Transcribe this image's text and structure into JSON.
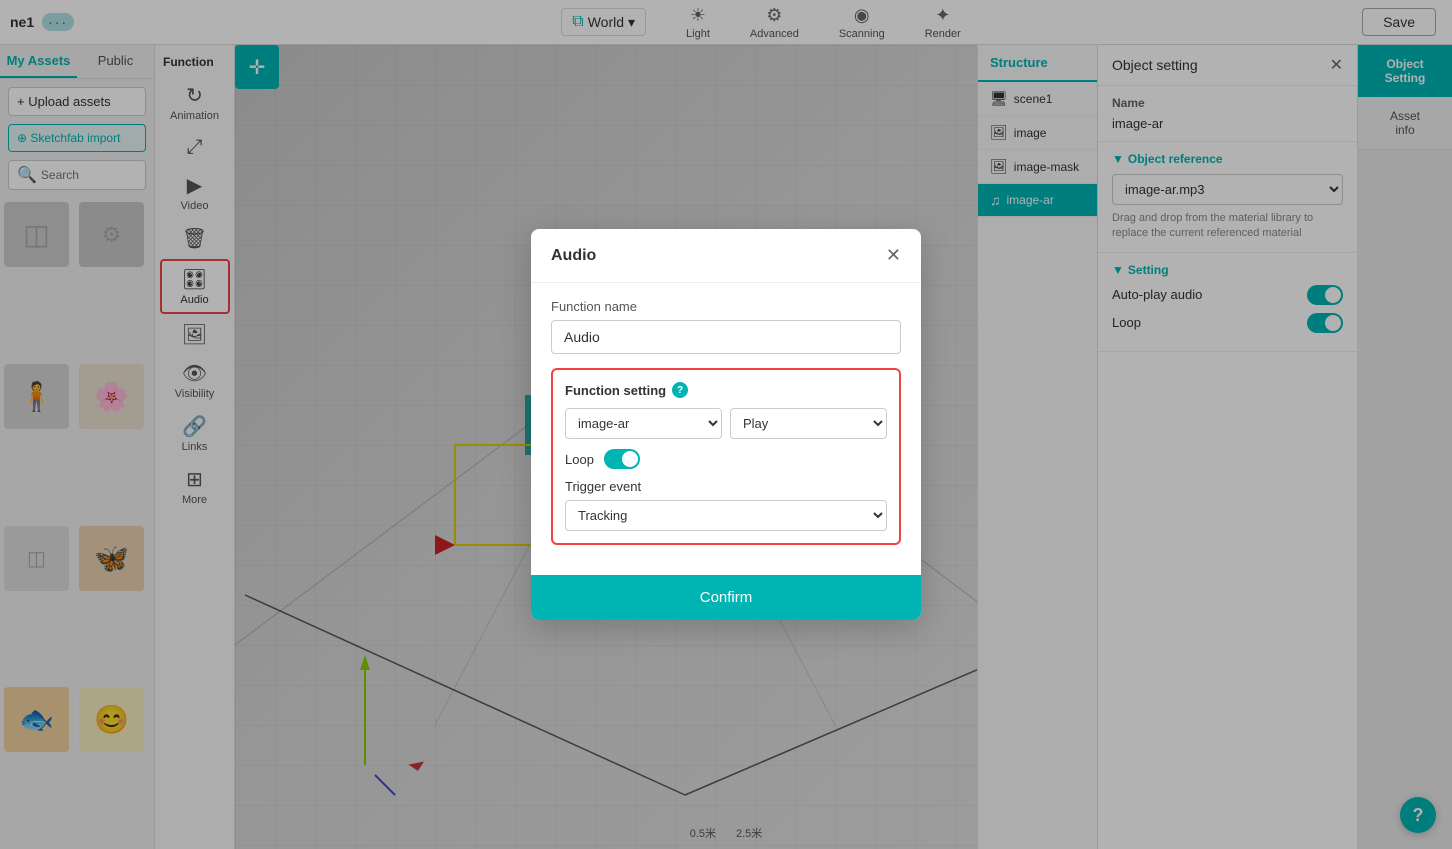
{
  "app": {
    "name": "ne1",
    "save_label": "Save"
  },
  "topbar": {
    "world_label": "World",
    "light_label": "Light",
    "advanced_label": "Advanced",
    "scanning_label": "Scanning",
    "render_label": "Render"
  },
  "left_panel": {
    "tab_my_assets": "My Assets",
    "tab_public": "Public",
    "upload_label": "+ Upload assets",
    "sketchfab_label": "⊕ Sketchfab import",
    "search_placeholder": "Search"
  },
  "function_sidebar": {
    "header": "Function",
    "items": [
      {
        "id": "animation",
        "label": "Animation",
        "icon": "↻"
      },
      {
        "id": "fullscreen",
        "label": "",
        "icon": "⤢"
      },
      {
        "id": "video",
        "label": "Video",
        "icon": "▶"
      },
      {
        "id": "delete",
        "label": "",
        "icon": "🗑"
      },
      {
        "id": "audio",
        "label": "Audio",
        "icon": "🎛",
        "active": true
      },
      {
        "id": "image",
        "label": "",
        "icon": "🖼"
      },
      {
        "id": "visibility",
        "label": "Visibility",
        "icon": "👁"
      },
      {
        "id": "links",
        "label": "Links",
        "icon": "🔗"
      },
      {
        "id": "more",
        "label": "More",
        "icon": "⋯"
      }
    ]
  },
  "object_setting_panel": {
    "title": "Object setting",
    "name_label": "Name",
    "name_value": "image-ar",
    "object_reference_label": "Object reference",
    "object_reference_value": "image-ar.mp3",
    "drag_hint": "Drag and drop from the material library to replace the current referenced material",
    "setting_label": "Setting",
    "auto_play_label": "Auto-play audio",
    "loop_label": "Loop"
  },
  "structure_panel": {
    "header": "Structure",
    "items": [
      {
        "id": "scene1",
        "label": "scene1",
        "icon": "🖥"
      },
      {
        "id": "image",
        "label": "image",
        "icon": "🖼"
      },
      {
        "id": "image-mask",
        "label": "image-mask",
        "icon": "🖼"
      },
      {
        "id": "image-ar",
        "label": "image-ar",
        "icon": "♫",
        "active": true
      }
    ]
  },
  "sidebar_buttons": {
    "obj_setting": "Object\nSetting",
    "asset_info": "Asset\ninfo"
  },
  "modal": {
    "title": "Audio",
    "function_name_label": "Function name",
    "function_name_value": "Audio",
    "function_setting_label": "Function setting",
    "help_icon": "?",
    "target_value": "image-ar",
    "action_value": "Play",
    "loop_label": "Loop",
    "trigger_event_label": "Trigger event",
    "trigger_value": "Tracking",
    "confirm_label": "Confirm"
  },
  "scale": {
    "val1": "0.5米",
    "val2": "2.5米"
  },
  "colors": {
    "teal": "#00b4b4",
    "red_border": "#e44444",
    "active_tab": "#00b4b4"
  }
}
